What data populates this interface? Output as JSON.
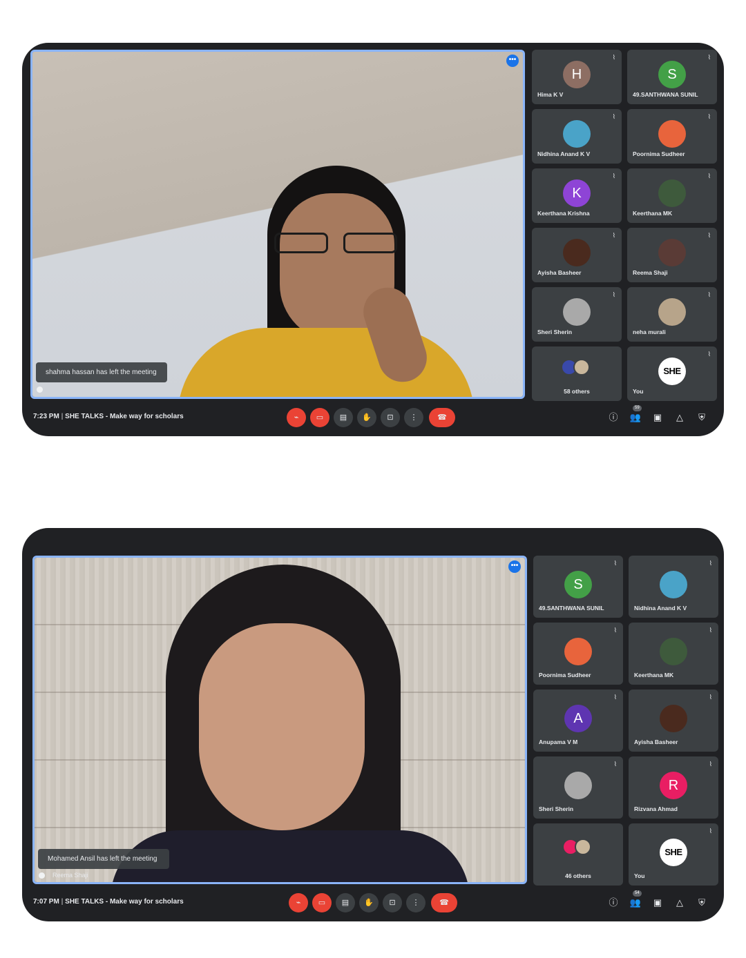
{
  "meetings": [
    {
      "toast": "shahma hassan has left the meeting",
      "speaker_name": "",
      "time": "7:23 PM",
      "meeting_title": "SHE TALKS - Make way for scholars",
      "participants_badge": "59",
      "tiles": [
        {
          "name": "Hima K V",
          "initial": "H",
          "color": "#8d6e63"
        },
        {
          "name": "49.SANTHWANA SUNIL",
          "initial": "S",
          "color": "#43a047"
        },
        {
          "name": "Nidhina Anand K V",
          "initial": "",
          "color": "#4aa3c8"
        },
        {
          "name": "Poornima Sudheer",
          "initial": "",
          "color": "#e8643c"
        },
        {
          "name": "Keerthana Krishna",
          "initial": "K",
          "color": "#8e44d6"
        },
        {
          "name": "Keerthana MK",
          "initial": "",
          "color": "#3e5a3c"
        },
        {
          "name": "Ayisha Basheer",
          "initial": "",
          "color": "#4a2a1e"
        },
        {
          "name": "Reema Shaji",
          "initial": "",
          "color": "#5a3b36"
        },
        {
          "name": "Sheri Sherin",
          "initial": "",
          "color": "#a9a9a9"
        },
        {
          "name": "neha murali",
          "initial": "",
          "color": "#b7a48a"
        },
        {
          "name": "58 others",
          "initial": "",
          "color": "#3c4043"
        },
        {
          "name": "You",
          "initial": "SHE",
          "color": "#ffffff"
        }
      ]
    },
    {
      "toast": "Mohamed Ansil has left the meeting",
      "speaker_name": "Reema Shaji",
      "time": "7:07 PM",
      "meeting_title": "SHE TALKS - Make way for scholars",
      "participants_badge": "54",
      "tiles": [
        {
          "name": "49.SANTHWANA SUNIL",
          "initial": "S",
          "color": "#43a047"
        },
        {
          "name": "Nidhina Anand K V",
          "initial": "",
          "color": "#4aa3c8"
        },
        {
          "name": "Poornima Sudheer",
          "initial": "",
          "color": "#e8643c"
        },
        {
          "name": "Keerthana MK",
          "initial": "",
          "color": "#3e5a3c"
        },
        {
          "name": "Anupama V M",
          "initial": "A",
          "color": "#5e35b1"
        },
        {
          "name": "Ayisha Basheer",
          "initial": "",
          "color": "#4a2a1e"
        },
        {
          "name": "Sheri Sherin",
          "initial": "",
          "color": "#a9a9a9"
        },
        {
          "name": "Rizvana Ahmad",
          "initial": "R",
          "color": "#e91e63"
        },
        {
          "name": "46 others",
          "initial": "",
          "color": "#3c4043"
        },
        {
          "name": "You",
          "initial": "SHE",
          "color": "#ffffff"
        }
      ]
    }
  ],
  "icons": {
    "mic_off": "mic-off-icon",
    "cam_off": "camera-off-icon",
    "captions": "captions-icon",
    "raise_hand": "raise-hand-icon",
    "present": "present-screen-icon",
    "more": "more-options-icon",
    "end_call": "end-call-icon",
    "info": "info-icon",
    "people": "people-icon",
    "chat": "chat-icon",
    "activities": "activities-icon",
    "host": "host-controls-icon"
  },
  "colors": {
    "background": "#202124",
    "tile": "#3c4043",
    "accent": "#8ab4f8",
    "danger": "#ea4335"
  }
}
